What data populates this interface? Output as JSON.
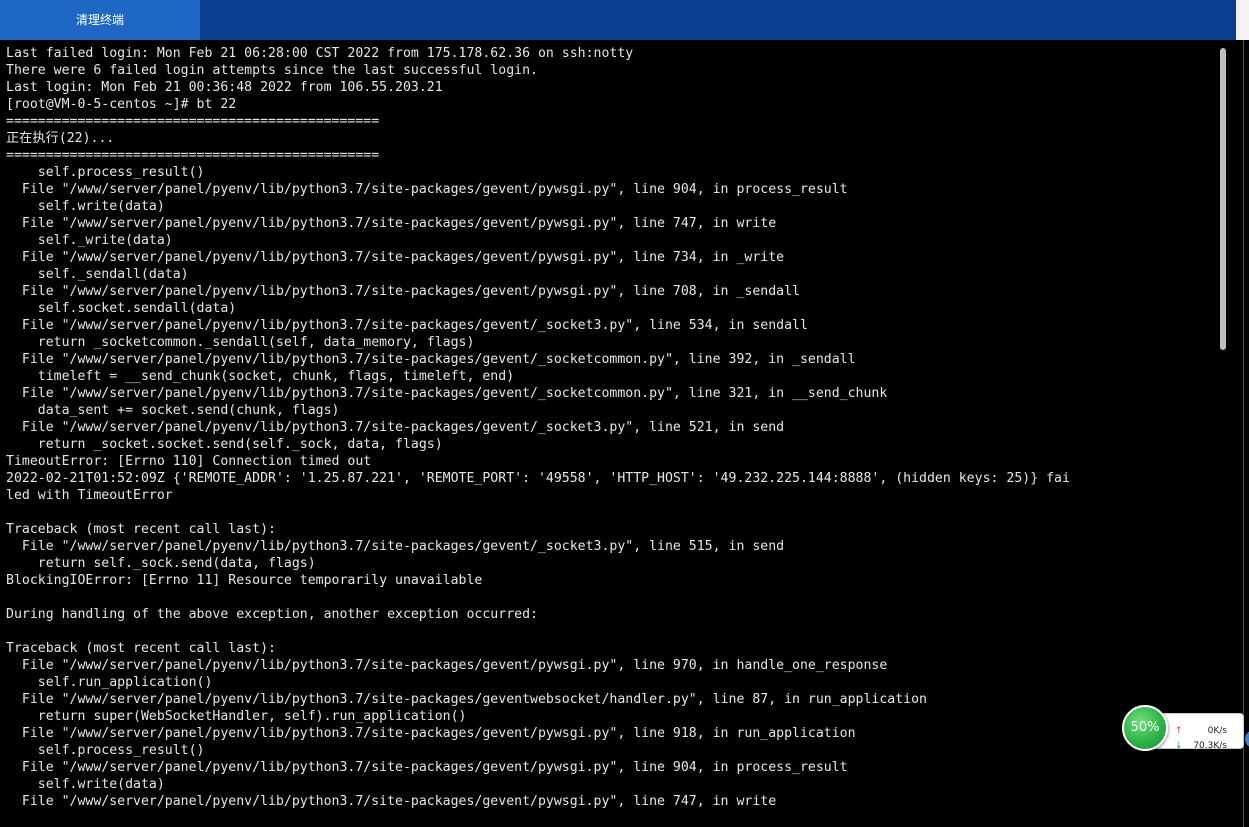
{
  "toolbar": {
    "clear_terminal_label": "清理终端"
  },
  "terminal": {
    "lines": [
      "Last failed login: Mon Feb 21 06:28:00 CST 2022 from 175.178.62.36 on ssh:notty",
      "There were 6 failed login attempts since the last successful login.",
      "Last login: Mon Feb 21 00:36:48 2022 from 106.55.203.21",
      "[root@VM-0-5-centos ~]# bt 22",
      "===============================================",
      "正在执行(22)...",
      "===============================================",
      "    self.process_result()",
      "  File \"/www/server/panel/pyenv/lib/python3.7/site-packages/gevent/pywsgi.py\", line 904, in process_result",
      "    self.write(data)",
      "  File \"/www/server/panel/pyenv/lib/python3.7/site-packages/gevent/pywsgi.py\", line 747, in write",
      "    self._write(data)",
      "  File \"/www/server/panel/pyenv/lib/python3.7/site-packages/gevent/pywsgi.py\", line 734, in _write",
      "    self._sendall(data)",
      "  File \"/www/server/panel/pyenv/lib/python3.7/site-packages/gevent/pywsgi.py\", line 708, in _sendall",
      "    self.socket.sendall(data)",
      "  File \"/www/server/panel/pyenv/lib/python3.7/site-packages/gevent/_socket3.py\", line 534, in sendall",
      "    return _socketcommon._sendall(self, data_memory, flags)",
      "  File \"/www/server/panel/pyenv/lib/python3.7/site-packages/gevent/_socketcommon.py\", line 392, in _sendall",
      "    timeleft = __send_chunk(socket, chunk, flags, timeleft, end)",
      "  File \"/www/server/panel/pyenv/lib/python3.7/site-packages/gevent/_socketcommon.py\", line 321, in __send_chunk",
      "    data_sent += socket.send(chunk, flags)",
      "  File \"/www/server/panel/pyenv/lib/python3.7/site-packages/gevent/_socket3.py\", line 521, in send",
      "    return _socket.socket.send(self._sock, data, flags)",
      "TimeoutError: [Errno 110] Connection timed out",
      "2022-02-21T01:52:09Z {'REMOTE_ADDR': '1.25.87.221', 'REMOTE_PORT': '49558', 'HTTP_HOST': '49.232.225.144:8888', (hidden keys: 25)} fai",
      "led with TimeoutError",
      "",
      "Traceback (most recent call last):",
      "  File \"/www/server/panel/pyenv/lib/python3.7/site-packages/gevent/_socket3.py\", line 515, in send",
      "    return self._sock.send(data, flags)",
      "BlockingIOError: [Errno 11] Resource temporarily unavailable",
      "",
      "During handling of the above exception, another exception occurred:",
      "",
      "Traceback (most recent call last):",
      "  File \"/www/server/panel/pyenv/lib/python3.7/site-packages/gevent/pywsgi.py\", line 970, in handle_one_response",
      "    self.run_application()",
      "  File \"/www/server/panel/pyenv/lib/python3.7/site-packages/geventwebsocket/handler.py\", line 87, in run_application",
      "    return super(WebSocketHandler, self).run_application()",
      "  File \"/www/server/panel/pyenv/lib/python3.7/site-packages/gevent/pywsgi.py\", line 918, in run_application",
      "    self.process_result()",
      "  File \"/www/server/panel/pyenv/lib/python3.7/site-packages/gevent/pywsgi.py\", line 904, in process_result",
      "    self.write(data)",
      "  File \"/www/server/panel/pyenv/lib/python3.7/site-packages/gevent/pywsgi.py\", line 747, in write"
    ]
  },
  "network_widget": {
    "percent": "50%",
    "upload_speed": "0K/s",
    "download_speed": "70.3K/s",
    "icons": {
      "up": "arrow-up-icon",
      "down": "arrow-down-icon",
      "plus": "plus-icon"
    }
  },
  "colors": {
    "topbar": "#0a3f8f",
    "button": "#1f67c4",
    "terminal_bg": "#000000",
    "terminal_text": "#e6e6e6",
    "ball_green": "#2fb24a",
    "up_arrow": "#e03a2f",
    "down_arrow": "#2fa84a",
    "plus_blue": "#3a7fd6"
  }
}
